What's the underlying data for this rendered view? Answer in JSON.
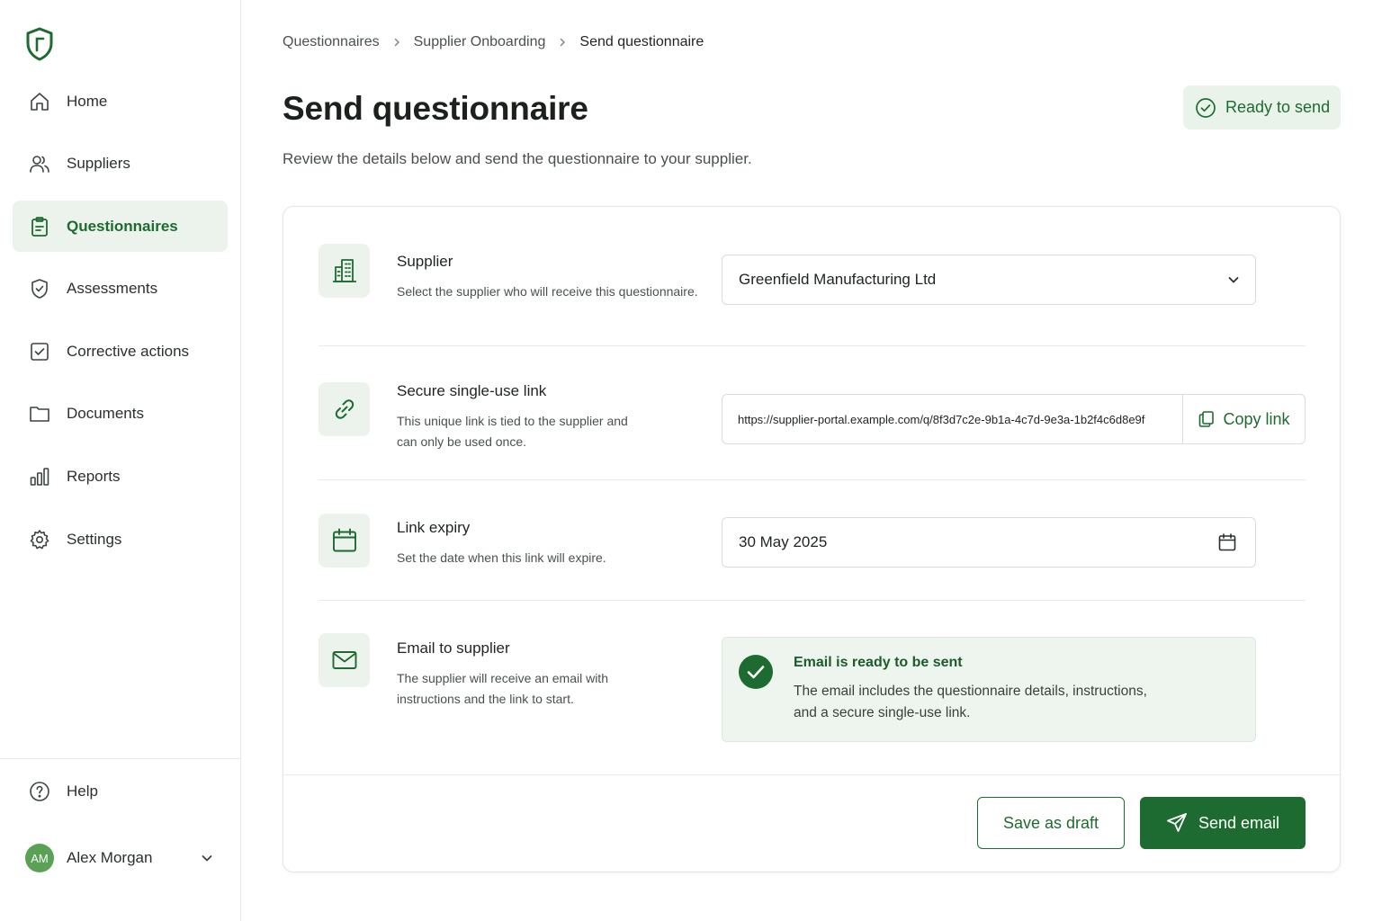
{
  "colors": {
    "accent": "#1d6b30",
    "accent_light": "#ebf3ec",
    "avatar": "#5aa155"
  },
  "sidebar": {
    "items": [
      {
        "label": "Home",
        "icon": "home-icon"
      },
      {
        "label": "Suppliers",
        "icon": "users-icon"
      },
      {
        "label": "Questionnaires",
        "icon": "clipboard-icon",
        "active": true
      },
      {
        "label": "Assessments",
        "icon": "shield-check-icon"
      },
      {
        "label": "Corrective actions",
        "icon": "checkbox-icon"
      },
      {
        "label": "Documents",
        "icon": "folder-icon"
      },
      {
        "label": "Reports",
        "icon": "bar-chart-icon"
      },
      {
        "label": "Settings",
        "icon": "gear-icon"
      }
    ],
    "help_label": "Help",
    "user": {
      "initials": "AM",
      "name": "Alex Morgan"
    }
  },
  "breadcrumb": [
    "Questionnaires",
    "Supplier Onboarding",
    "Send questionnaire"
  ],
  "page": {
    "title": "Send questionnaire",
    "subtitle": "Review the details below and send the questionnaire to your supplier.",
    "status": "Ready to send"
  },
  "form": {
    "supplier": {
      "title": "Supplier",
      "desc": "Select the supplier who will receive this questionnaire.",
      "value": "Greenfield Manufacturing Ltd"
    },
    "link": {
      "title": "Secure single-use link",
      "desc": "This unique link is tied to the supplier and can only be used once.",
      "value": "https://supplier-portal.example.com/q/8f3d7c2e-9b1a-4c7d-9e3a-1b2f4c6d8e9f",
      "copy_label": "Copy link"
    },
    "expiry": {
      "title": "Link expiry",
      "desc": "Set the date when this link will expire.",
      "value": "30 May 2025"
    },
    "email": {
      "title": "Email to supplier",
      "desc": "The supplier will receive an email with instructions and the link to start.",
      "notice_title": "Email is ready to be sent",
      "notice_text": "The email includes the questionnaire details, instructions, and a secure single-use link."
    }
  },
  "actions": {
    "draft": "Save as draft",
    "send": "Send email"
  }
}
